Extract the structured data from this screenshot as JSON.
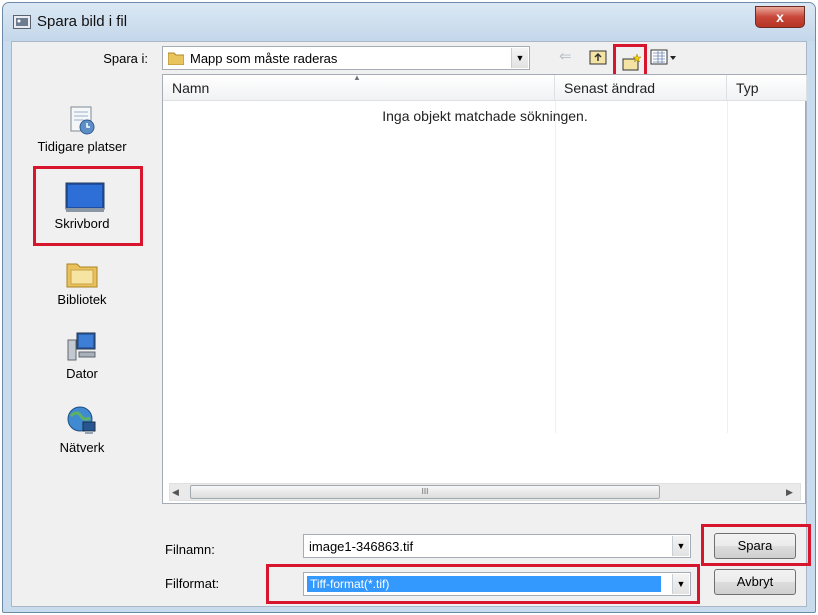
{
  "window": {
    "title": "Spara bild i fil",
    "close_label": "x"
  },
  "save_in": {
    "label": "Spara i:",
    "folder": "Mapp som måste raderas"
  },
  "toolbar": {
    "back_icon": "back-arrow-icon",
    "up_icon": "up-folder-icon",
    "new_folder_icon": "new-folder-icon",
    "views_icon": "views-menu-icon"
  },
  "places": [
    {
      "label": "Tidigare platser",
      "icon": "recent-places-icon"
    },
    {
      "label": "Skrivbord",
      "icon": "desktop-icon"
    },
    {
      "label": "Bibliotek",
      "icon": "libraries-icon"
    },
    {
      "label": "Dator",
      "icon": "computer-icon"
    },
    {
      "label": "Nätverk",
      "icon": "network-icon"
    }
  ],
  "file_list": {
    "columns": [
      "Namn",
      "Senast ändrad",
      "Typ"
    ],
    "empty_message": "Inga objekt matchade sökningen.",
    "scroll_thumb_label": "III"
  },
  "filename": {
    "label": "Filnamn:",
    "value": "image1-346863.tif"
  },
  "format": {
    "label": "Filformat:",
    "value": "Tiff-format(*.tif)"
  },
  "buttons": {
    "save": "Spara",
    "cancel": "Avbryt"
  },
  "colors": {
    "highlight_red": "#d7152c",
    "selection_blue": "#3399ff",
    "title_bar": "#c4d7ea"
  }
}
